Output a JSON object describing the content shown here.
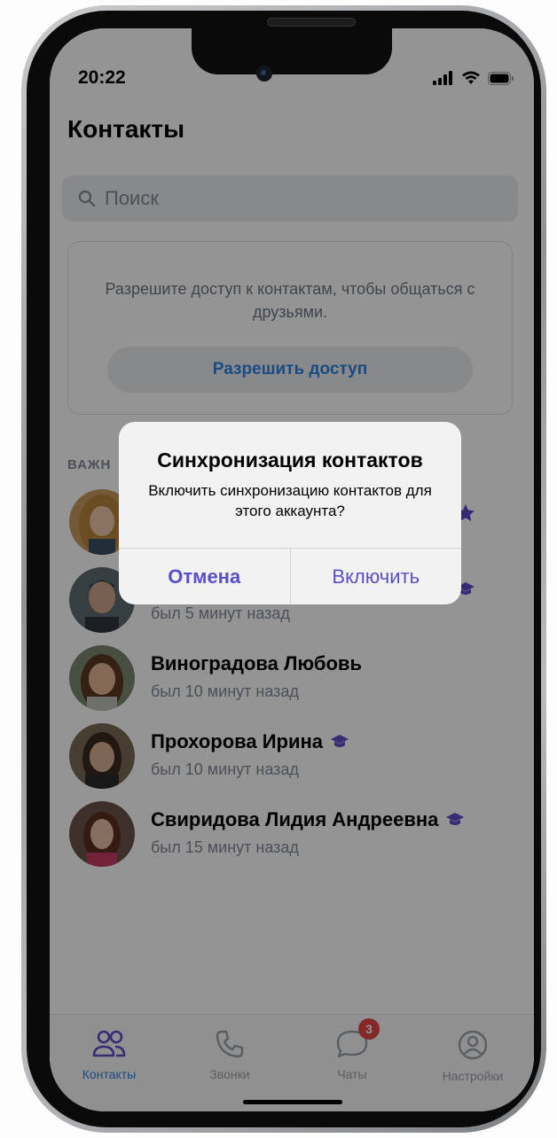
{
  "status_bar": {
    "time": "20:22"
  },
  "header": {
    "title": "Контакты"
  },
  "search": {
    "placeholder": "Поиск"
  },
  "permission_card": {
    "text": "Разрешите доступ к контактам, чтобы общаться с друзьями.",
    "button_label": "Разрешить доступ"
  },
  "section_label": "ВАЖН",
  "contacts": [
    {
      "name": "",
      "status": "",
      "badge_icon": "star-badge-icon"
    },
    {
      "name": "",
      "status": "был 5 минут назад",
      "badge_icon": "graduation-cap-icon"
    },
    {
      "name": "Виноградова Любовь",
      "status": "был 10 минут назад"
    },
    {
      "name": "Прохорова Ирина",
      "status": "был 10 минут назад",
      "badge_icon": "graduation-cap-icon"
    },
    {
      "name": "Свиридова Лидия Андреевна",
      "status": "был 15 минут назад",
      "badge_icon": "graduation-cap-icon"
    }
  ],
  "tabbar": {
    "tabs": [
      {
        "label": "Контакты",
        "icon": "users-icon",
        "active": true
      },
      {
        "label": "Звонки",
        "icon": "phone-icon"
      },
      {
        "label": "Чаты",
        "icon": "chat-bubble-icon",
        "badge": "3"
      },
      {
        "label": "Настройки",
        "icon": "profile-circle-icon"
      }
    ]
  },
  "dialog": {
    "title": "Синхронизация контактов",
    "message": "Включить синхронизацию контактов для этого аккаунта?",
    "cancel_label": "Отмена",
    "confirm_label": "Включить"
  },
  "colors": {
    "accent": "#2d81e0",
    "dialog_button": "#5b4fc8",
    "badge": "#e64646",
    "verified": "#5b4fc8"
  }
}
